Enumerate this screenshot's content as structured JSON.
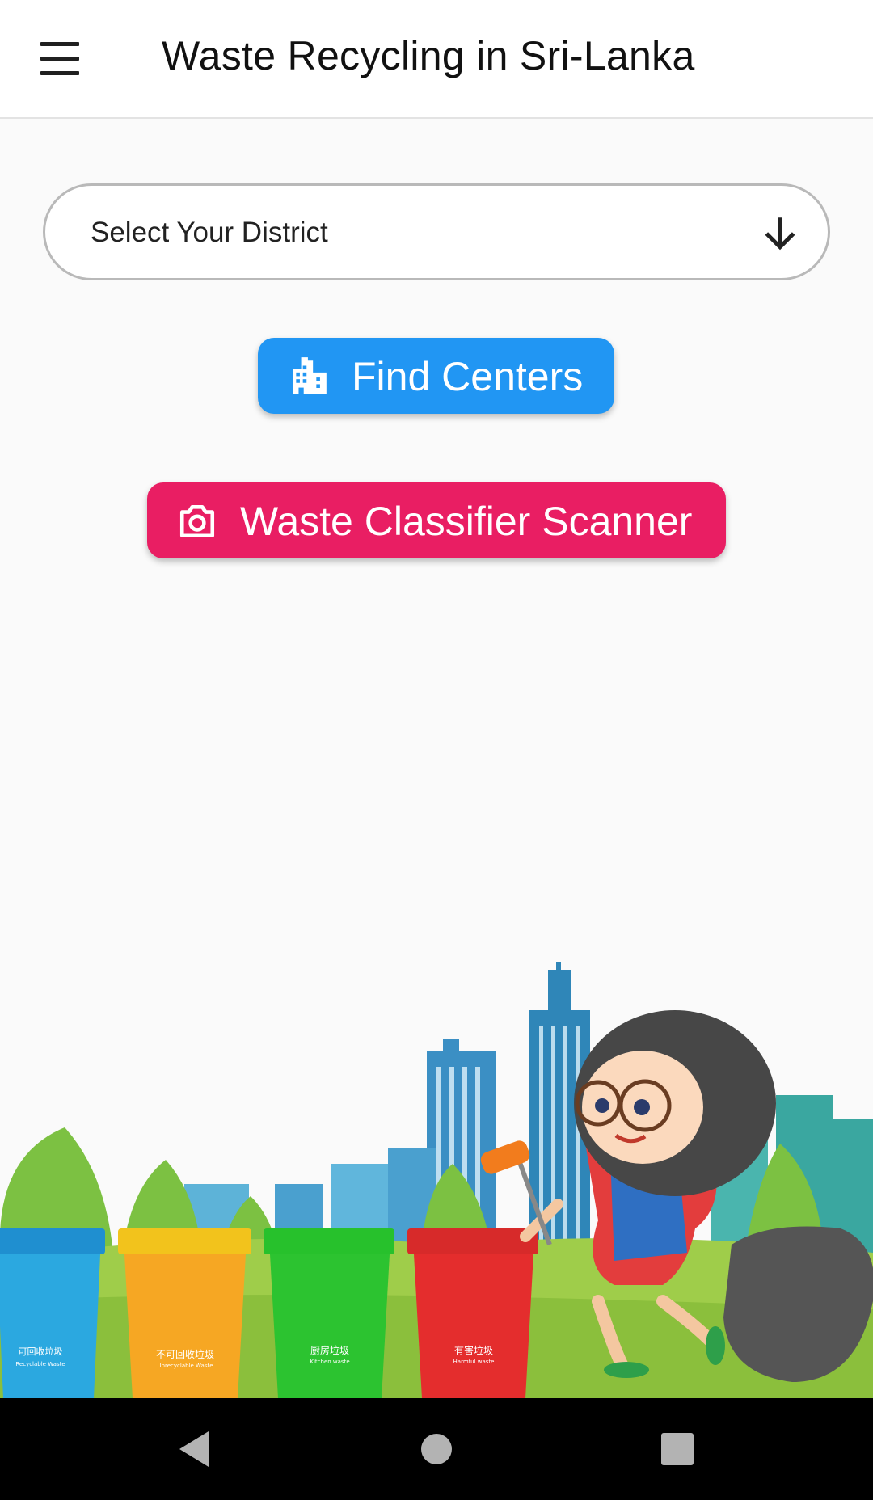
{
  "app_bar": {
    "title": "Waste Recycling in Sri-Lanka",
    "menu_icon": "hamburger-menu-icon"
  },
  "district_select": {
    "placeholder": "Select Your District",
    "icon": "arrow-down-icon"
  },
  "find_centers": {
    "label": "Find Centers",
    "icon": "apartment-building-icon",
    "color": "#2196F3"
  },
  "scanner": {
    "label": "Waste Classifier Scanner",
    "icon": "camera-icon",
    "color": "#E91E63"
  },
  "illustration": {
    "bins": [
      {
        "cn": "可回收垃圾",
        "en": "Recyclable Waste",
        "color": "#2ba8e0"
      },
      {
        "cn": "不可回收垃圾",
        "en": "Unrecyclable Waste",
        "color": "#f6a723"
      },
      {
        "cn": "厨房垃圾",
        "en": "Kitchen waste",
        "color": "#2cc330"
      },
      {
        "cn": "有害垃圾",
        "en": "Harmful waste",
        "color": "#e42d2d"
      }
    ]
  },
  "system_nav": {
    "back_icon": "back-triangle-icon",
    "home_icon": "home-circle-icon",
    "recents_icon": "recents-square-icon"
  }
}
